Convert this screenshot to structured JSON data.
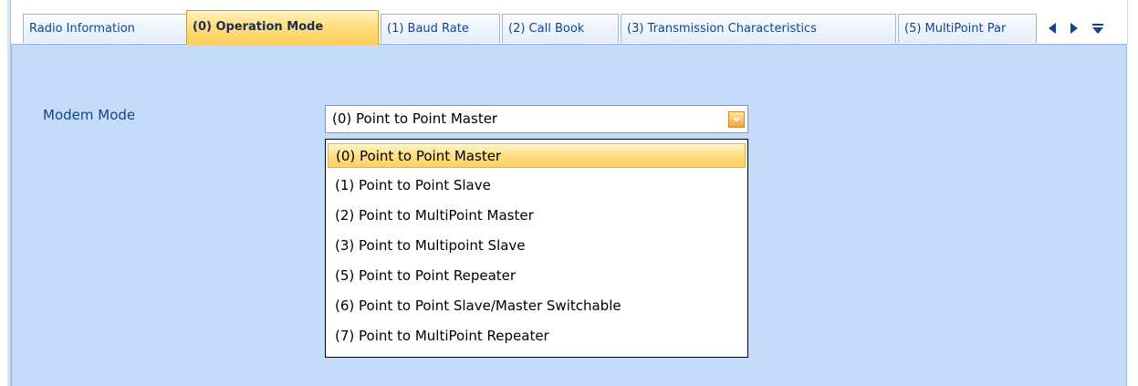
{
  "tabs": [
    {
      "label": "Radio Information",
      "active": false
    },
    {
      "label": "(0) Operation Mode",
      "active": true
    },
    {
      "label": "(1) Baud Rate",
      "active": false
    },
    {
      "label": "(2) Call Book",
      "active": false
    },
    {
      "label": "(3) Transmission Characteristics",
      "active": false
    },
    {
      "label": "(5) MultiPoint Par",
      "active": false
    }
  ],
  "tab_nav": {
    "prev_icon": "triangle-left-icon",
    "next_icon": "triangle-right-icon",
    "overflow_icon": "overflow-menu-icon"
  },
  "form": {
    "modem_mode_label": "Modem Mode",
    "modem_mode_value": "(0) Point to Point Master",
    "dropdown_icon": "chevron-down-icon",
    "options": [
      "(0) Point to Point Master",
      "(1) Point to Point Slave",
      "(2) Point to MultiPoint Master",
      "(3) Point to Multipoint Slave",
      "(5) Point to Point Repeater",
      "(6) Point to Point Slave/Master Switchable",
      "(7) Point to MultiPoint Repeater"
    ],
    "highlighted_option": "(0) Point to Point Master"
  },
  "colors": {
    "panel_background": "#c4dcf9",
    "active_tab": "#ffd064",
    "text": "#15428b",
    "highlight": "#ffe08a"
  }
}
